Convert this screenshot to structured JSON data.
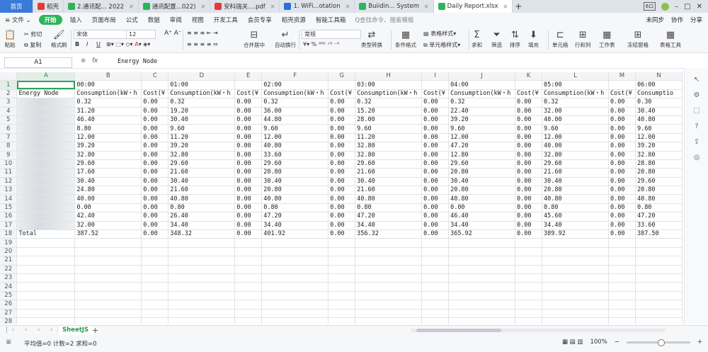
{
  "tabs": [
    {
      "label": "首页",
      "color": "#3a7ad8"
    },
    {
      "label": "稻壳",
      "color": "#e53935"
    },
    {
      "label": "2.通讯配... 2022",
      "color": "#2fb45a"
    },
    {
      "label": "通讯配置...022)",
      "color": "#2fb45a"
    },
    {
      "label": "安科瑞关....pdf",
      "color": "#e53935"
    },
    {
      "label": "1. WiFi...otation",
      "color": "#2b6fd6"
    },
    {
      "label": "Buiidin... System",
      "color": "#2fb45a"
    },
    {
      "label": "Daily Report.xlsx",
      "color": "#2fb45a"
    }
  ],
  "window": {
    "layout_badge": "6口",
    "min": "–",
    "max": "□",
    "close": "✕"
  },
  "menu": {
    "file": "≡ 文件 ⌄",
    "start": "开始",
    "items": [
      "插入",
      "页面布局",
      "公式",
      "数据",
      "审阅",
      "视图",
      "开发工具",
      "会员专享",
      "稻壳资源",
      "智能工具箱"
    ],
    "search": "Q查找命令、搜索模板",
    "right": [
      "未同步",
      "协作",
      "分享"
    ]
  },
  "ribbon": {
    "cut": "剪切",
    "copy": "复制",
    "format_painter": "格式刷",
    "paste": "粘贴",
    "font": "宋体",
    "size": "12",
    "bold": "B",
    "italic": "I",
    "underline": "U",
    "merge": "合并居中",
    "wrap": "自动换行",
    "numfmt": "常规",
    "convert": "类型转换",
    "cond": "条件格式",
    "table_style": "表格样式",
    "cell_style": "单元格样式",
    "sum": "求和",
    "filter": "筛选",
    "sort": "排序",
    "fill": "填充",
    "cells": "单元格",
    "rowcol": "行和列",
    "sheet": "工作表",
    "freeze": "冻结窗格",
    "tools": "表格工具"
  },
  "formula_bar": {
    "cell": "A1",
    "fx": "fx",
    "content": "Energy Node"
  },
  "columns": [
    "A",
    "B",
    "C",
    "D",
    "E",
    "F",
    "G",
    "H",
    "I",
    "J",
    "K",
    "L",
    "M",
    "N"
  ],
  "hours": [
    "00:00",
    "01:00",
    "02:00",
    "03:00",
    "04:00",
    "05:00",
    "06:00"
  ],
  "header_row": {
    "node": "Energy Node",
    "consumption": "Consumption(kW・h",
    "cost": "Cost(¥",
    "last_consumption": "Consumptio"
  },
  "rows": [
    {
      "node": "1F50",
      "values": [
        "0.32",
        "0.00",
        "0.32",
        "0.00",
        "0.32",
        "0.00",
        "0.32",
        "0.00",
        "0.32",
        "0.00",
        "0.32",
        "0.00",
        "0.30"
      ]
    },
    {
      "node": "N",
      "values": [
        "31.20",
        "0.00",
        "19.20",
        "0.00",
        "36.00",
        "0.00",
        "15.20",
        "0.00",
        "22.40",
        "0.00",
        "32.00",
        "0.00",
        "30.40"
      ]
    },
    {
      "node": "M",
      "values": [
        "46.40",
        "0.00",
        "30.40",
        "0.00",
        "44.80",
        "0.00",
        "28.00",
        "0.00",
        "39.20",
        "0.00",
        "40.00",
        "0.00",
        "40.80"
      ]
    },
    {
      "node": "M",
      "values": [
        "8.80",
        "0.00",
        "9.60",
        "0.00",
        "9.60",
        "0.00",
        "9.60",
        "0.00",
        "9.60",
        "0.00",
        "9.60",
        "0.00",
        "9.60"
      ]
    },
    {
      "node": "M",
      "values": [
        "12.00",
        "0.00",
        "11.20",
        "0.00",
        "12.00",
        "0.00",
        "11.20",
        "0.00",
        "12.00",
        "0.00",
        "12.00",
        "0.00",
        "12.00"
      ]
    },
    {
      "node": "M",
      "values": [
        "39.20",
        "0.00",
        "39.20",
        "0.00",
        "40.80",
        "0.00",
        "32.80",
        "0.00",
        "47.20",
        "0.00",
        "40.00",
        "0.00",
        "39.20"
      ]
    },
    {
      "node": "M",
      "values": [
        "32.80",
        "0.00",
        "32.80",
        "0.00",
        "33.60",
        "0.00",
        "32.80",
        "0.00",
        "12.80",
        "0.00",
        "32.80",
        "0.00",
        "32.80"
      ]
    },
    {
      "node": "M",
      "values": [
        "29.60",
        "0.00",
        "29.60",
        "0.00",
        "29.60",
        "0.00",
        "29.60",
        "0.00",
        "29.60",
        "0.00",
        "29.60",
        "0.00",
        "28.80"
      ]
    },
    {
      "node": "M",
      "values": [
        "17.60",
        "0.00",
        "21.60",
        "0.00",
        "20.80",
        "0.00",
        "21.60",
        "0.00",
        "20.80",
        "0.00",
        "21.60",
        "0.00",
        "20.80"
      ]
    },
    {
      "node": "M",
      "values": [
        "30.40",
        "0.00",
        "30.40",
        "0.00",
        "30.40",
        "0.00",
        "30.40",
        "0.00",
        "30.40",
        "0.00",
        "30.40",
        "0.00",
        "29.60"
      ]
    },
    {
      "node": "M",
      "values": [
        "24.80",
        "0.00",
        "21.60",
        "0.00",
        "20.80",
        "0.00",
        "21.60",
        "0.00",
        "20.80",
        "0.00",
        "20.80",
        "0.00",
        "20.80"
      ]
    },
    {
      "node": "M",
      "values": [
        "40.00",
        "0.00",
        "40.80",
        "0.00",
        "40.80",
        "0.00",
        "40.80",
        "0.00",
        "40.80",
        "0.00",
        "40.80",
        "0.00",
        "40.80"
      ]
    },
    {
      "node": "M",
      "values": [
        "0.00",
        "0.00",
        "0.80",
        "0.00",
        "0.80",
        "0.00",
        "0.80",
        "0.00",
        "0.00",
        "0.00",
        "0.80",
        "0.00",
        "0.80"
      ]
    },
    {
      "node": "M",
      "values": [
        "42.40",
        "0.00",
        "26.40",
        "0.00",
        "47.20",
        "0.00",
        "47.20",
        "0.00",
        "46.40",
        "0.00",
        "45.60",
        "0.00",
        "47.20"
      ]
    },
    {
      "node": "M",
      "values": [
        "32.00",
        "0.00",
        "34.40",
        "0.00",
        "34.40",
        "0.00",
        "34.40",
        "0.00",
        "34.40",
        "0.00",
        "34.40",
        "0.00",
        "33.60"
      ]
    },
    {
      "node": "Total",
      "values": [
        "387.52",
        "0.00",
        "348.32",
        "0.00",
        "401.92",
        "0.00",
        "356.32",
        "0.00",
        "365.92",
        "0.00",
        "389.92",
        "0.00",
        "387.50"
      ]
    }
  ],
  "sheet_tab": "SheetJS",
  "status": {
    "left": "平均值=0  计数=2  求和=0",
    "zoom": "100%"
  }
}
